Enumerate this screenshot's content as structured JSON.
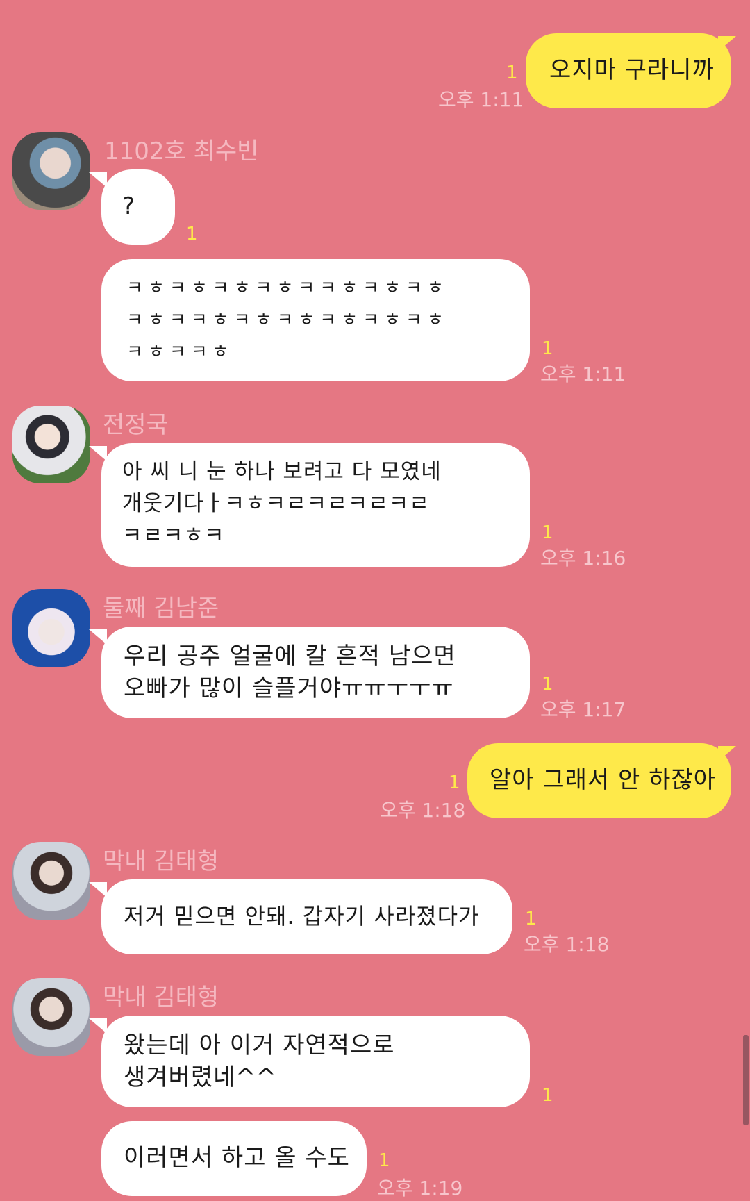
{
  "messages": [
    {
      "from": "me",
      "text": "오지마 구라니까",
      "unread": "1",
      "time": "오후 1:11"
    },
    {
      "sender": "1102호 최수빈",
      "avatar": "avatar-soobin",
      "texts": [
        {
          "text": "?",
          "unread": "1"
        },
        {
          "text": "ㅋㅎㅋㅎㅋㅎㅋㅎㅋㅋㅎㅋㅎㅋㅎ\nㅋㅎㅋㅋㅎㅋㅎㅋㅎㅋㅎㅋㅎㅋㅎ\nㅋㅎㅋㅋㅎ",
          "unread": "1",
          "time": "오후 1:11"
        }
      ]
    },
    {
      "sender": "전정국",
      "avatar": "avatar-jungkook",
      "texts": [
        {
          "text": "아 씨 니 눈 하나 보려고 다 모였네\n개웃기다ㅏㅋㅎㅋㄹㅋㄹㅋㄹㅋㄹ\nㅋㄹㅋㅎㅋ",
          "unread": "1",
          "time": "오후 1:16"
        }
      ]
    },
    {
      "sender": "둘째 김남준",
      "avatar": "avatar-namjoon",
      "texts": [
        {
          "text": "우리 공주 얼굴에 칼 흔적 남으면\n오빠가 많이 슬플거야ㅠㅠㅜㅜㅠ",
          "unread": "1",
          "time": "오후 1:17"
        }
      ]
    },
    {
      "from": "me",
      "text": "알아 그래서 안 하잖아",
      "unread": "1",
      "time": "오후 1:18"
    },
    {
      "sender": "막내 김태형",
      "avatar": "avatar-taehyung",
      "texts": [
        {
          "text": "저거 믿으면 안돼. 갑자기 사라졌다가",
          "unread": "1",
          "time": "오후 1:18"
        }
      ]
    },
    {
      "sender": "막내 김태형",
      "avatar": "avatar-taehyung",
      "texts": [
        {
          "text": "왔는데 아 이거 자연적으로\n생겨버렸네^^",
          "unread": "1"
        },
        {
          "text": "이러면서 하고 올 수도",
          "unread": "1",
          "time": "오후 1:19"
        }
      ]
    }
  ],
  "colors": {
    "background": "#e57783",
    "my_bubble": "#fee94a",
    "their_bubble": "#ffffff",
    "unread": "#fee94a"
  }
}
